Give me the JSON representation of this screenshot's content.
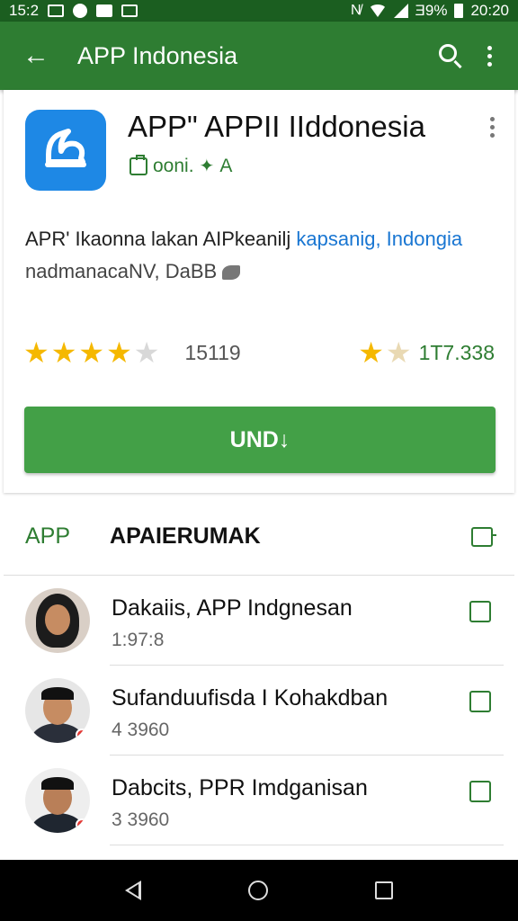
{
  "status_bar": {
    "time_left": "15:2",
    "battery": "Ǝ9%",
    "time": "20:20"
  },
  "app_bar": {
    "title": "APP Indonesia"
  },
  "app": {
    "name": "APP\" APPII IIddonesia",
    "developer": "ooni.",
    "developer_suffix": "A",
    "description_line1": "APR' Ikaonna lakan AIPkeanilj ",
    "description_link": "kapsanig, Indongia",
    "description_line2": "nadmanacaNV, DaBB",
    "rating": 4,
    "rating_max": 5,
    "rating_count": "15119",
    "downloads": "1T7.338",
    "install_label": "UND↓",
    "icon_color": "#1e88e5"
  },
  "reviews_section": {
    "left_label": "APP",
    "title": "APAIERUMAK",
    "items": [
      {
        "name": "Dakaiis, APP Indgnesan",
        "meta": "1:97:8"
      },
      {
        "name": "Sufanduufisda I Kohakdban",
        "meta": "4 3960"
      },
      {
        "name": "Dabcits, PPR Imdganisan",
        "meta": "3 3960"
      }
    ]
  },
  "colors": {
    "primary": "#2e7d32",
    "accent": "#43a047",
    "link": "#1976d2",
    "star": "#f5b800"
  }
}
